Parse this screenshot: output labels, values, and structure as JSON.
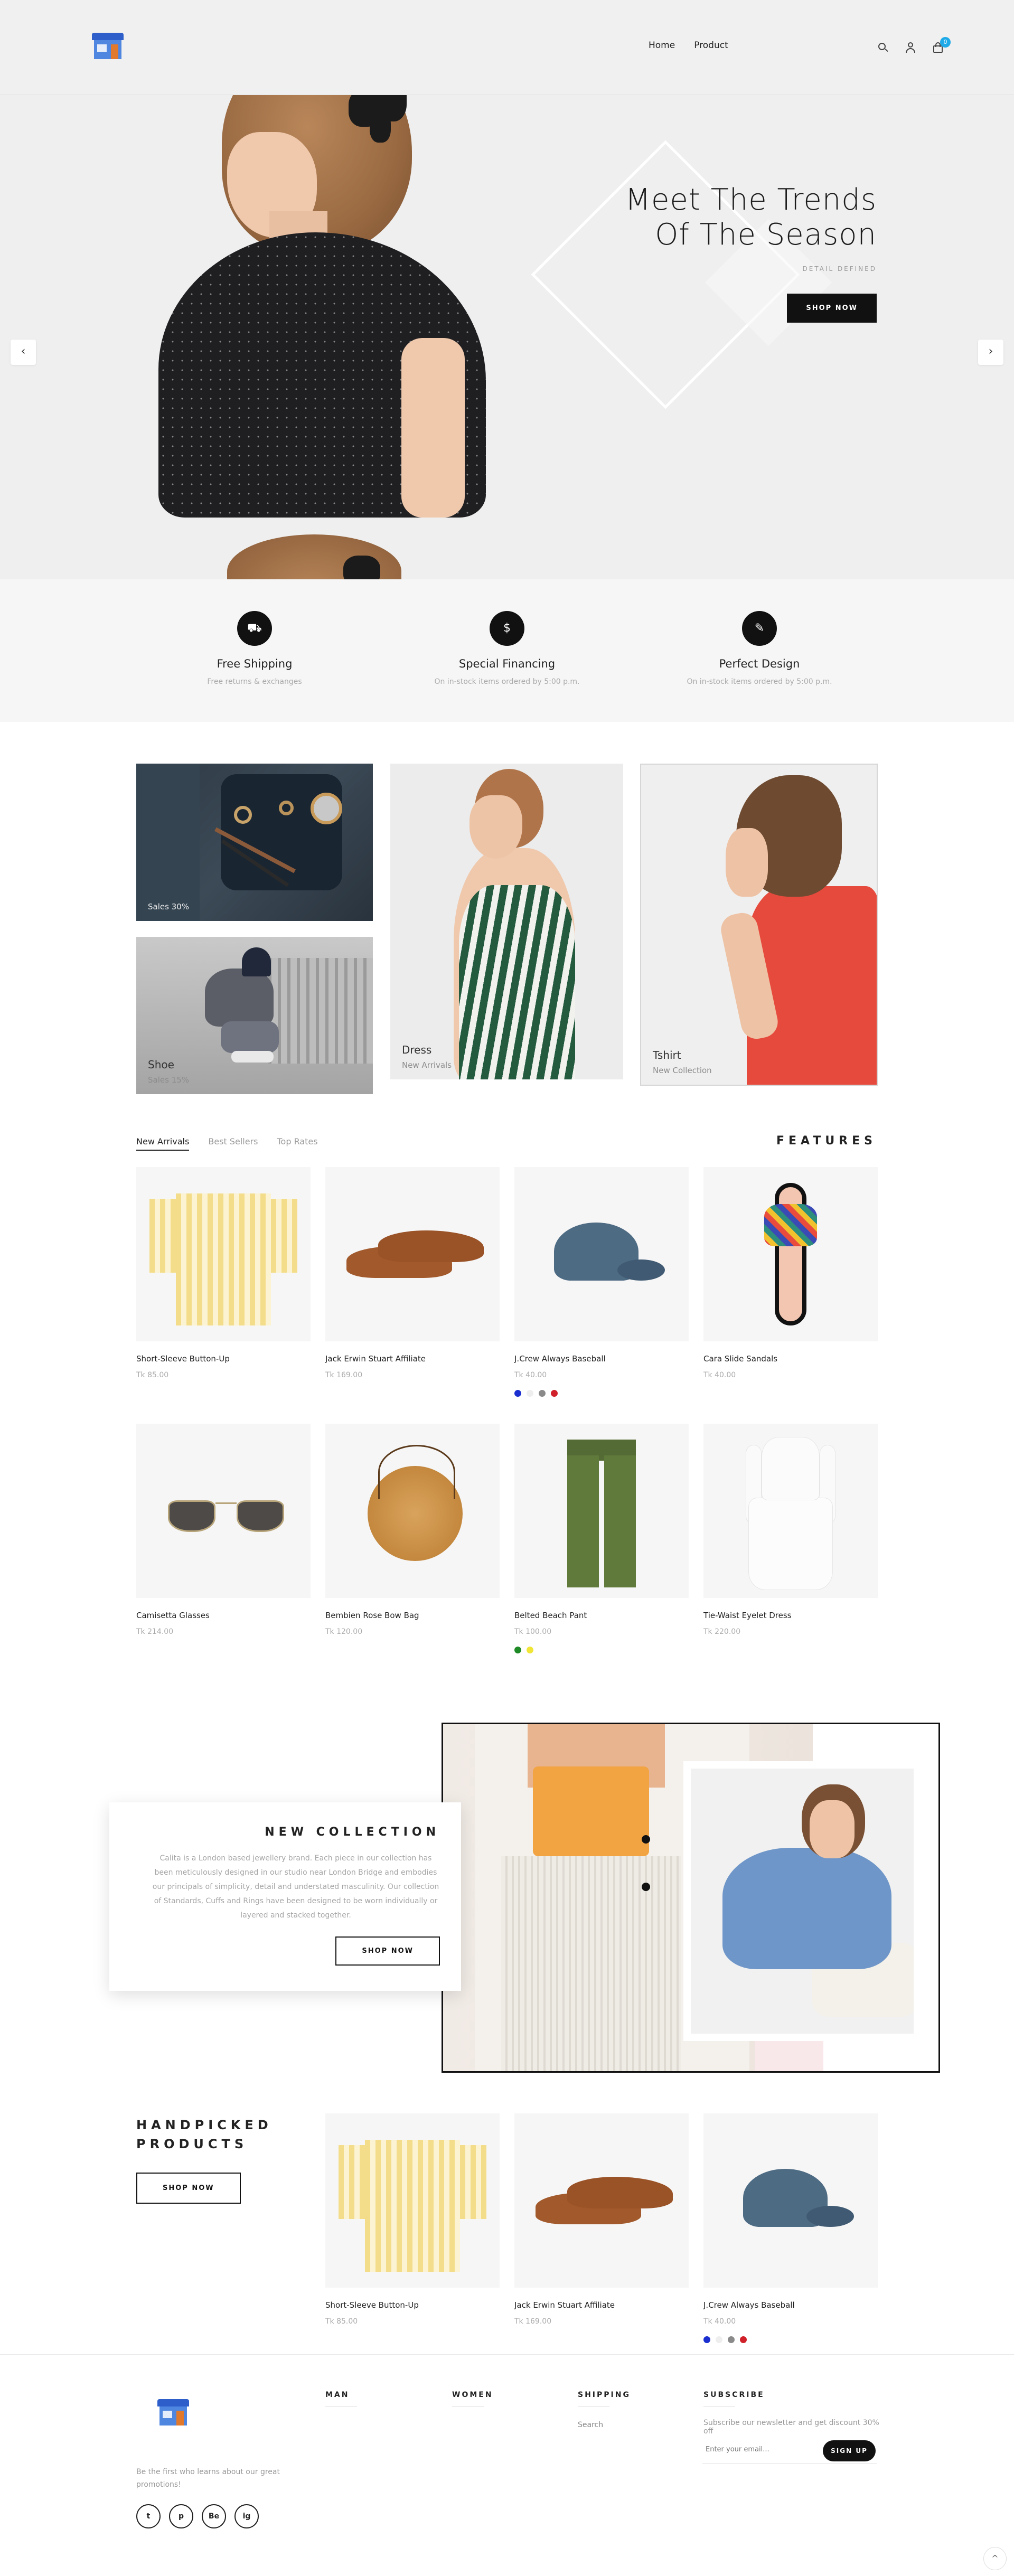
{
  "header": {
    "nav": [
      "Home",
      "Product"
    ],
    "cart_count": "0"
  },
  "hero": {
    "title": "Meet The Trends\nOf The Season",
    "subtitle": "DETAIL DEFINED",
    "button": "SHOP NOW",
    "prev": "‹",
    "next": "›"
  },
  "services": [
    {
      "icon": "free-shipping-icon",
      "title": "Free Shipping",
      "subtitle": "Free returns & exchanges"
    },
    {
      "icon": "financing-icon",
      "title": "Special Financing",
      "subtitle": "On in-stock items ordered by 5:00 p.m."
    },
    {
      "icon": "design-icon",
      "title": "Perfect Design",
      "subtitle": "On in-stock items ordered by 5:00 p.m."
    }
  ],
  "banners": {
    "accessories": {
      "label": "",
      "subtitle": "Sales 30%"
    },
    "shoe": {
      "label": "Shoe",
      "subtitle": "Sales 15%"
    },
    "dress": {
      "label": "Dress",
      "subtitle": "New Arrivals"
    },
    "tshirt": {
      "label": "Tshirt",
      "subtitle": "New Collection"
    }
  },
  "tabs": [
    "New Arrivals",
    "Best Sellers",
    "Top Rates"
  ],
  "features_heading": "FEATURES",
  "products": [
    {
      "name": "Short-Sleeve Button-Up",
      "price": "Tk 85.00",
      "swatches": []
    },
    {
      "name": "Jack Erwin Stuart Affiliate",
      "price": "Tk 169.00",
      "swatches": []
    },
    {
      "name": "J.Crew Always Baseball",
      "price": "Tk 40.00",
      "swatches": [
        "#1b2fd0",
        "#eeeeee",
        "#8a8a8a",
        "#d0202a"
      ]
    },
    {
      "name": "Cara Slide Sandals",
      "price": "Tk 40.00",
      "swatches": []
    },
    {
      "name": "Camisetta Glasses",
      "price": "Tk 214.00",
      "swatches": []
    },
    {
      "name": "Bembien Rose Bow Bag",
      "price": "Tk 120.00",
      "swatches": []
    },
    {
      "name": "Belted Beach Pant",
      "price": "Tk 100.00",
      "swatches": [
        "#1e8a26",
        "#f1e637"
      ]
    },
    {
      "name": "Tie-Waist Eyelet Dress",
      "price": "Tk 220.00",
      "swatches": []
    }
  ],
  "collection": {
    "title": "NEW COLLECTION",
    "text": "Calita is a London based jewellery brand. Each piece in our collection has been meticulously designed in our studio near London Bridge and embodies our principals of simplicity, detail and understated masculinity. Our collection of Standards, Cuffs and Rings have been designed to be worn individually or layered and stacked together.",
    "button": "SHOP NOW"
  },
  "handpicked": {
    "title": "HANDPICKED\nPRODUCTS",
    "button": "SHOP NOW",
    "products": [
      {
        "name": "Short-Sleeve Button-Up",
        "price": "Tk 85.00",
        "swatches": []
      },
      {
        "name": "Jack Erwin Stuart Affiliate",
        "price": "Tk 169.00",
        "swatches": []
      },
      {
        "name": "J.Crew Always Baseball",
        "price": "Tk 40.00",
        "swatches": [
          "#1b2fd0",
          "#eeeeee",
          "#8a8a8a",
          "#d0202a"
        ]
      }
    ]
  },
  "footer": {
    "tagline": "Be the first who learns about our great promotions!",
    "social": [
      "t",
      "p",
      "Be",
      "ig"
    ],
    "cols": [
      {
        "head": "MAN",
        "links": []
      },
      {
        "head": "WOMEN",
        "links": []
      },
      {
        "head": "SHIPPING",
        "links": [
          "Search"
        ]
      }
    ],
    "subscribe": {
      "head": "SUBSCRIBE",
      "text": "Subscribe our newsletter and get discount 30% off",
      "placeholder": "Enter your email...",
      "button": "SIGN UP"
    },
    "to_top": "^"
  }
}
